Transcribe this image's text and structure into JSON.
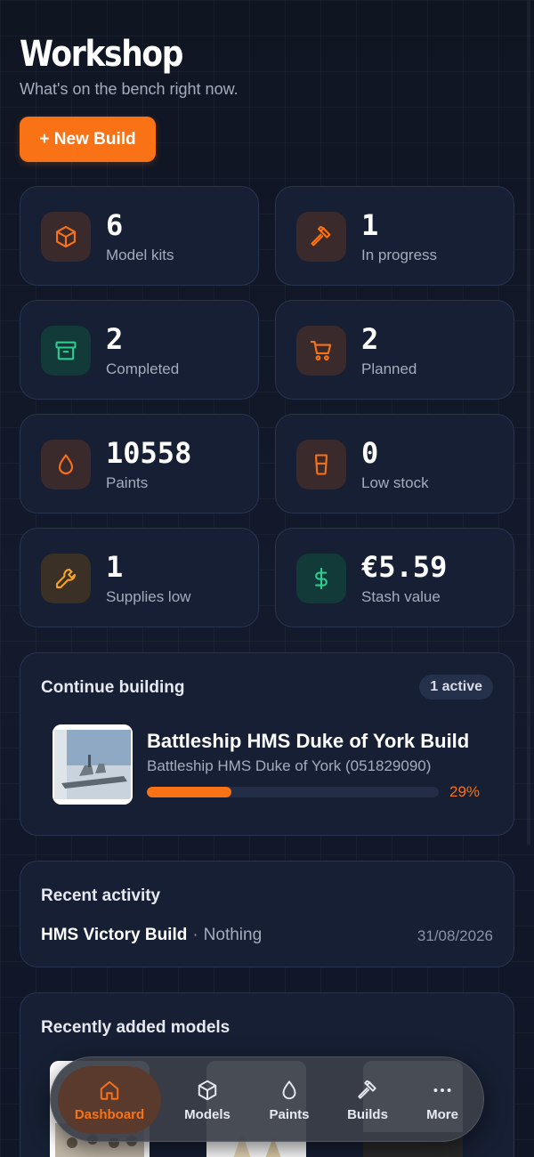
{
  "header": {
    "title": "Workshop",
    "subtitle": "What's on the bench right now.",
    "new_build_label": "+ New Build"
  },
  "stats": [
    {
      "value": "6",
      "label": "Model kits",
      "icon": "cube-icon",
      "tone": "orange"
    },
    {
      "value": "1",
      "label": "In progress",
      "icon": "hammer-icon",
      "tone": "orange"
    },
    {
      "value": "2",
      "label": "Completed",
      "icon": "archive-icon",
      "tone": "green"
    },
    {
      "value": "2",
      "label": "Planned",
      "icon": "cart-icon",
      "tone": "orange"
    },
    {
      "value": "10558",
      "label": "Paints",
      "icon": "droplet-icon",
      "tone": "orange"
    },
    {
      "value": "0",
      "label": "Low stock",
      "icon": "paint-pot-icon",
      "tone": "orange"
    },
    {
      "value": "1",
      "label": "Supplies low",
      "icon": "wrench-icon",
      "tone": "amber"
    },
    {
      "value": "€5.59",
      "label": "Stash value",
      "icon": "dollar-icon",
      "tone": "green"
    }
  ],
  "continue": {
    "heading": "Continue building",
    "badge": "1 active",
    "build_title": "Battleship HMS Duke of York Build",
    "build_subtitle": "Battleship HMS Duke of York (051829090)",
    "progress": 29,
    "progress_label": "29%"
  },
  "activity": {
    "heading": "Recent activity",
    "item_name": "HMS Victory Build",
    "separator": "·",
    "item_detail": "Nothing",
    "item_date": "31/08/2026"
  },
  "recent_models": {
    "heading": "Recently added models"
  },
  "nav": {
    "items": [
      {
        "label": "Dashboard",
        "icon": "home-icon",
        "active": true
      },
      {
        "label": "Models",
        "icon": "cube-icon"
      },
      {
        "label": "Paints",
        "icon": "droplet-icon"
      },
      {
        "label": "Builds",
        "icon": "hammer-icon"
      },
      {
        "label": "More",
        "icon": "more-icon"
      }
    ]
  },
  "colors": {
    "accent": "#f97316",
    "success": "#2ecc8f",
    "warning": "#f5a524",
    "background": "#111827",
    "card": "#161f33"
  }
}
